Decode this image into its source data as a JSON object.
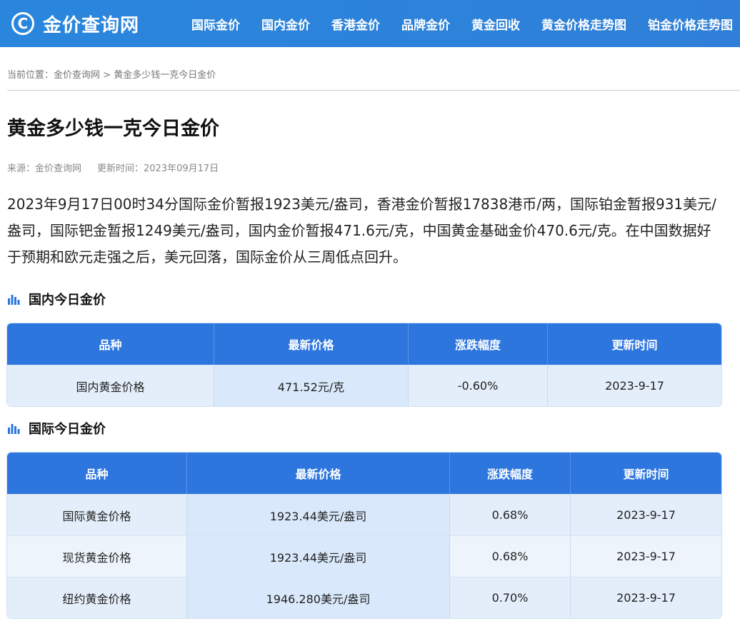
{
  "site": {
    "logo_symbol": "C",
    "logo_text": "金价查询网",
    "nav": [
      "国际金价",
      "国内金价",
      "香港金价",
      "品牌金价",
      "黄金回收",
      "黄金价格走势图",
      "铂金价格走势图"
    ]
  },
  "breadcrumb": {
    "prefix": "当前位置：",
    "home": "金价查询网",
    "separator": " > ",
    "current": "黄金多少钱一克今日金价"
  },
  "article": {
    "title": "黄金多少钱一克今日金价",
    "source": "来源：金价查询网",
    "updated": "更新时间：2023年09月17日",
    "summary": "2023年9月17日00时34分国际金价暂报1923美元/盎司，香港金价暂报17838港币/两，国际铂金暂报931美元/盎司，国际钯金暂报1249美元/盎司，国内金价暂报471.6元/克，中国黄金基础金价470.6元/克。在中国数据好于预期和欧元走强之后，美元回落，国际金价从三周低点回升。"
  },
  "domestic": {
    "title": "国内今日金价",
    "headers": [
      "品种",
      "最新价格",
      "涨跌幅度",
      "更新时间"
    ],
    "rows": [
      [
        "国内黄金价格",
        "471.52元/克",
        "-0.60%",
        "2023-9-17"
      ]
    ]
  },
  "international": {
    "title": "国际今日金价",
    "headers": [
      "品种",
      "最新价格",
      "涨跌幅度",
      "更新时间"
    ],
    "rows": [
      [
        "国际黄金价格",
        "1923.44美元/盎司",
        "0.68%",
        "2023-9-17"
      ],
      [
        "现货黄金价格",
        "1923.44美元/盎司",
        "0.68%",
        "2023-9-17"
      ],
      [
        "纽约黄金价格",
        "1946.280美元/盎司",
        "0.70%",
        "2023-9-17"
      ]
    ]
  },
  "colors": {
    "header_bg": "#2a86dd",
    "table_header": "#2d76de",
    "icon_blue": "#2d76de"
  }
}
